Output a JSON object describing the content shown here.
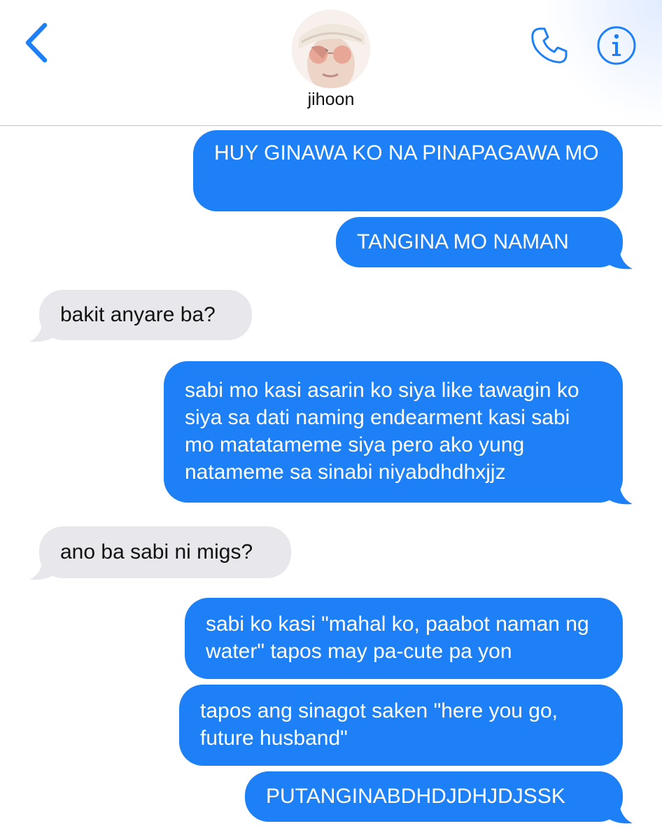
{
  "header": {
    "contact_name": "jihoon",
    "back_icon": "chevron-left-icon",
    "call_icon": "phone-icon",
    "info_icon": "info-icon",
    "accent_color": "#1e80f6"
  },
  "messages": [
    {
      "direction": "sent",
      "text": "HUY GINAWA KO NA PINAPAGAWA MO"
    },
    {
      "direction": "sent",
      "text": "TANGINA MO NAMAN"
    },
    {
      "direction": "received",
      "text": "bakit anyare ba?"
    },
    {
      "direction": "sent",
      "text": "sabi mo kasi asarin ko siya like tawagin ko siya sa dati naming endearment kasi sabi mo matatameme siya pero ako yung natameme sa sinabi niyabdhdhxjjz"
    },
    {
      "direction": "received",
      "text": "ano ba sabi ni migs?"
    },
    {
      "direction": "sent",
      "text": "sabi ko kasi \"mahal ko, paabot naman ng water\" tapos may pa-cute pa yon"
    },
    {
      "direction": "sent",
      "text": "tapos ang sinagot saken \"here you go, future husband\""
    },
    {
      "direction": "sent",
      "text": "PUTANGINABDHDJDHJDJSSK"
    }
  ],
  "colors": {
    "sent_bubble": "#1e80f6",
    "received_bubble": "#e8e8ec"
  }
}
